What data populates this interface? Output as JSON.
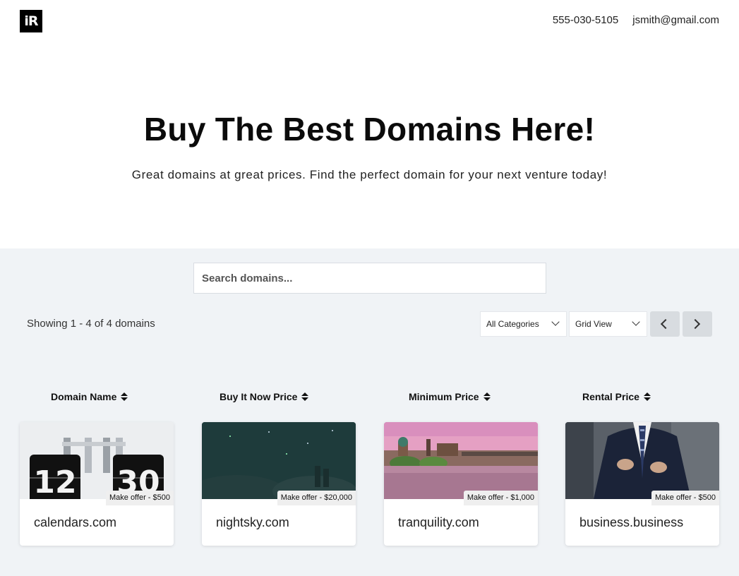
{
  "header": {
    "logo_text": "iR",
    "phone": "555-030-5105",
    "email": "jsmith@gmail.com"
  },
  "hero": {
    "title": "Buy The Best Domains Here!",
    "subtitle": "Great domains at great prices. Find the perfect domain for your next venture today!"
  },
  "search": {
    "placeholder": "Search domains..."
  },
  "listing": {
    "showing_text": "Showing 1 - 4 of 4 domains",
    "category_select": "All Categories",
    "view_select": "Grid View"
  },
  "sort_headers": [
    "Domain Name",
    "Buy It Now Price",
    "Minimum Price",
    "Rental Price"
  ],
  "domains": [
    {
      "name": "calendars.com",
      "badge": "Make offer - $500"
    },
    {
      "name": "nightsky.com",
      "badge": "Make offer - $20,000"
    },
    {
      "name": "tranquility.com",
      "badge": "Make offer - $1,000"
    },
    {
      "name": "business.business",
      "badge": "Make offer - $500"
    }
  ],
  "icons": {
    "sort": "sort-icon",
    "select": "chevron-down-icon",
    "prev": "chevron-left-icon",
    "next": "chevron-right-icon"
  },
  "colors": {
    "section_bg": "#f0f3f6",
    "pager_bg": "#d8dce0",
    "badge_bg": "#efefef"
  }
}
